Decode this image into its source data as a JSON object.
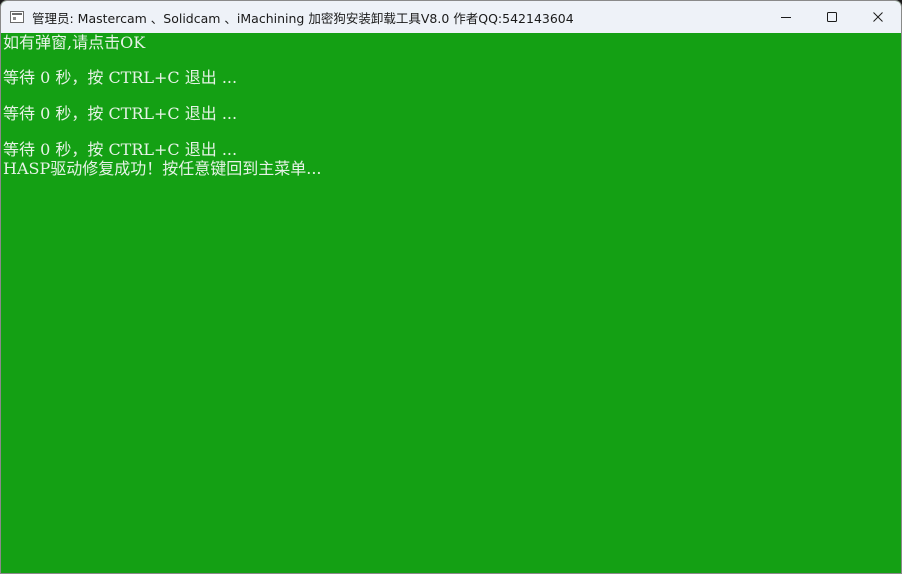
{
  "window": {
    "title": "管理员:  Mastercam 、Solidcam  、iMachining 加密狗安装卸载工具V8.0  作者QQ:542143604",
    "caption_buttons": [
      {
        "name": "minimize-icon"
      },
      {
        "name": "maximize-icon"
      },
      {
        "name": "close-icon"
      }
    ]
  },
  "console": {
    "background": "#14a014",
    "text_color": "#e6f3e6",
    "lines": [
      "如有弹窗,请点击OK",
      "等待 0 秒，按 CTRL+C 退出 ...",
      "等待 0 秒，按 CTRL+C 退出 ...",
      "等待 0 秒，按 CTRL+C 退出 ...",
      "HASP驱动修复成功！按任意键回到主菜单..."
    ]
  }
}
